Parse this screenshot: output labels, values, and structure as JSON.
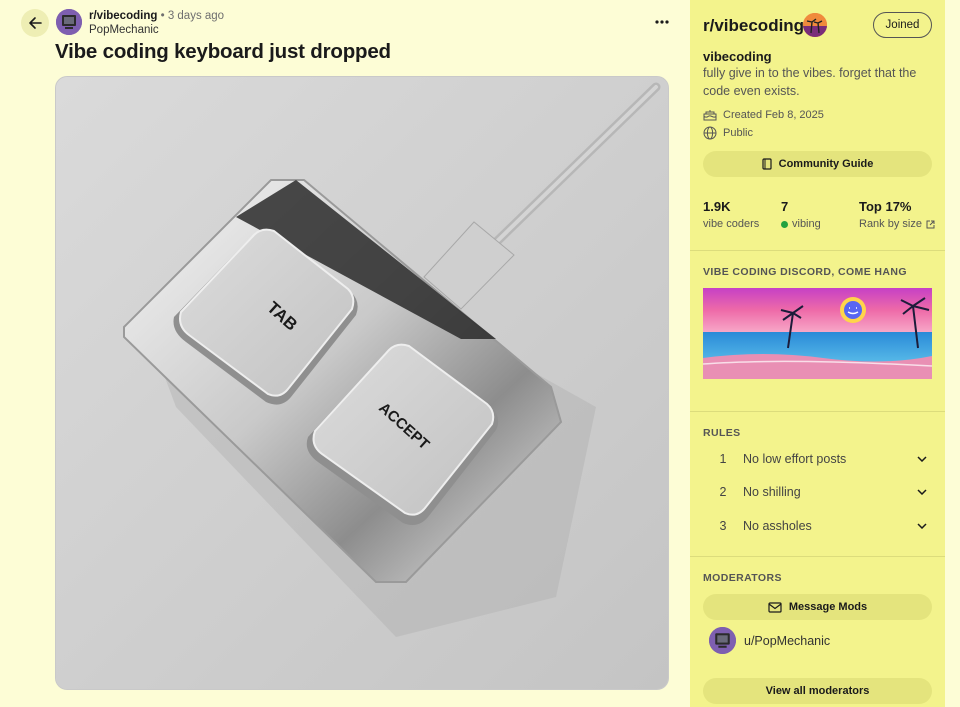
{
  "post": {
    "subreddit": "r/vibecoding",
    "separator": "•",
    "time": "3 days ago",
    "author": "PopMechanic",
    "title": "Vibe coding keyboard just dropped"
  },
  "keyboard": {
    "key1": "TAB",
    "key2": "ACCEPT"
  },
  "sidebar": {
    "heading": "r/vibecoding",
    "join_label": "Joined",
    "name": "vibecoding",
    "description": "fully give in to the vibes. forget that the code even exists.",
    "created": "Created Feb 8, 2025",
    "visibility": "Public",
    "guide_label": "Community Guide",
    "stats": [
      {
        "value": "1.9K",
        "label": "vibe coders"
      },
      {
        "value": "7",
        "label": "vibing"
      },
      {
        "value": "Top 17%",
        "label": "Rank by size"
      }
    ],
    "discord_title": "VIBE CODING DISCORD, COME HANG",
    "rules_title": "RULES",
    "rules": [
      {
        "num": "1",
        "text": "No low effort posts"
      },
      {
        "num": "2",
        "text": "No shilling"
      },
      {
        "num": "3",
        "text": "No assholes"
      }
    ],
    "moderators_title": "MODERATORS",
    "message_mods_label": "Message Mods",
    "moderator": "u/PopMechanic",
    "view_all_label": "View all moderators"
  },
  "colors": {
    "page_bg": "#fdfdd6",
    "sidebar_bg": "#f3f38c",
    "pill_bg": "#e4e47d",
    "online": "#23a23f"
  }
}
